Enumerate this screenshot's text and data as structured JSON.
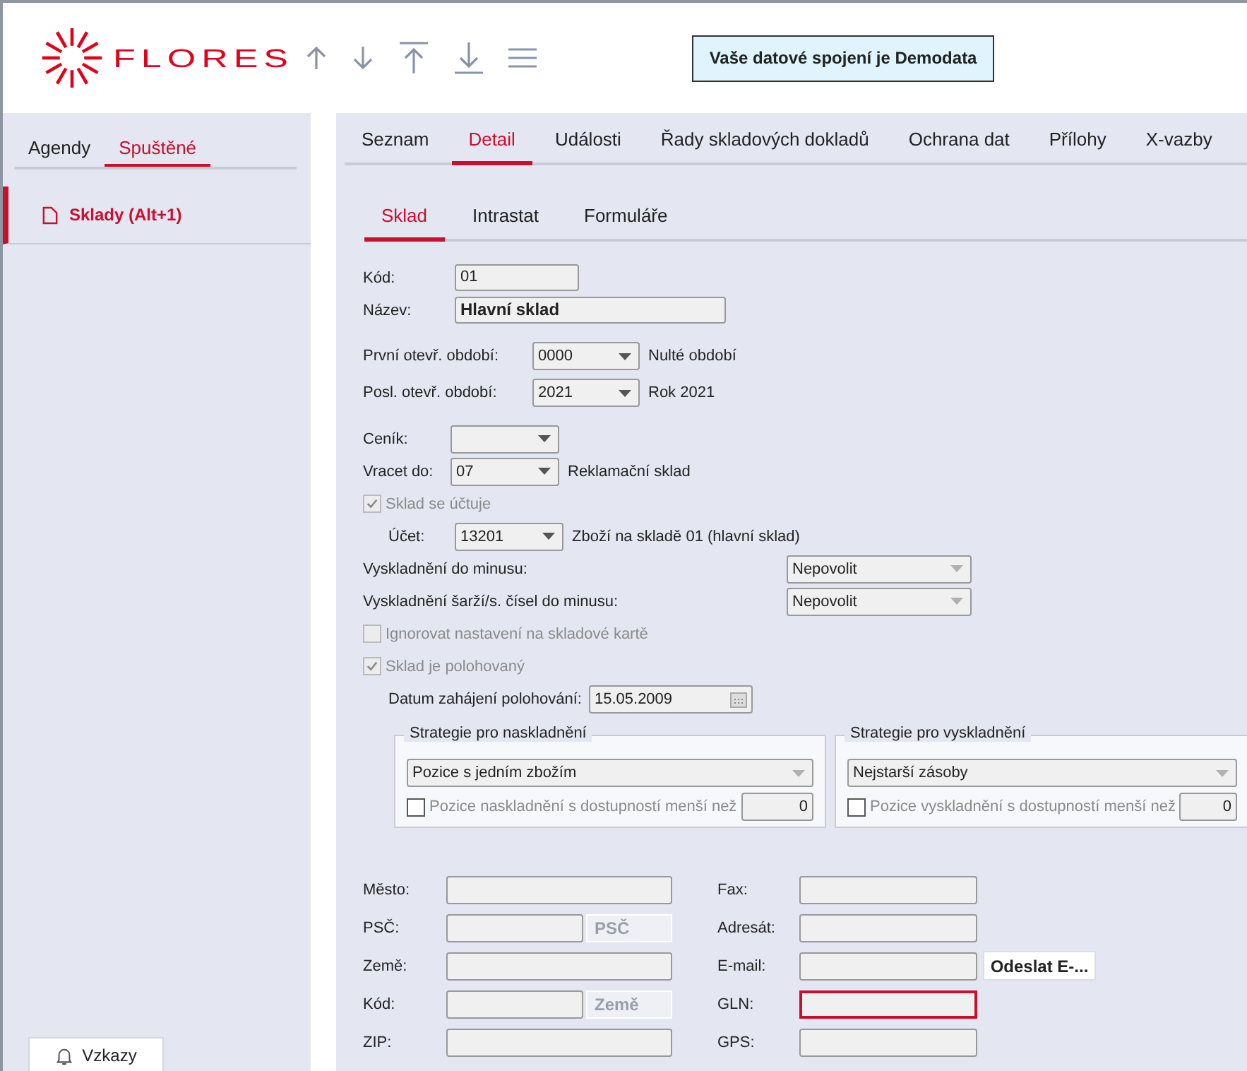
{
  "header": {
    "logo": "FLORES",
    "notice": "Vaše datové spojení je Demodata"
  },
  "sidebar": {
    "tabs": [
      {
        "label": "Agendy",
        "selected": false
      },
      {
        "label": "Spuštěné",
        "selected": true
      }
    ],
    "items": [
      {
        "label": "Sklady (Alt+1)",
        "selected": true
      }
    ],
    "messages_button": "Vzkazy"
  },
  "tabs": [
    {
      "label": "Seznam",
      "selected": false
    },
    {
      "label": "Detail",
      "selected": true
    },
    {
      "label": "Události",
      "selected": false
    },
    {
      "label": "Řady skladových dokladů",
      "selected": false
    },
    {
      "label": "Ochrana dat",
      "selected": false
    },
    {
      "label": "Přílohy",
      "selected": false
    },
    {
      "label": "X-vazby",
      "selected": false
    }
  ],
  "subtabs": [
    {
      "label": "Sklad",
      "selected": true
    },
    {
      "label": "Intrastat",
      "selected": false
    },
    {
      "label": "Formuláře",
      "selected": false
    }
  ],
  "form": {
    "basic": [
      {
        "label": "Kód:",
        "value": "01",
        "emphasis": false
      },
      {
        "label": "Název:",
        "value": "Hlavní sklad",
        "emphasis": true
      }
    ],
    "periods": [
      {
        "label": "První otevř. období:",
        "value": "0000",
        "note": "Nulté období"
      },
      {
        "label": "Posl. otevř. období:",
        "value": "2021",
        "note": "Rok 2021"
      }
    ],
    "lists": [
      {
        "label": "Ceník:"
      },
      {
        "label": "Vracet do:",
        "value": "07",
        "note": "Reklamační sklad"
      }
    ],
    "booked": {
      "label": "Sklad se účtuje",
      "checked": true,
      "disabled": true
    },
    "account": {
      "label": "Účet:",
      "value": "13201",
      "note": "Zboží na skladě 01 (hlavní sklad)"
    },
    "stock_out": [
      {
        "label": "Vyskladnění do minusu:",
        "value": "Nepovolit"
      },
      {
        "label": "Vyskladnění šarží/s. čísel do minusu:",
        "value": "Nepovolit"
      }
    ],
    "checks": [
      {
        "label": "Ignorovat nastavení na skladové kartě",
        "checked": false,
        "disabled": true
      },
      {
        "label": "Sklad je polohovaný",
        "checked": true,
        "disabled": true
      }
    ],
    "position_date": {
      "label": "Datum zahájení polohování:",
      "value": "15.05.2009"
    },
    "strategies": [
      {
        "title": "Strategie pro naskladnění",
        "value": "Pozice s jedním zbožím",
        "check_label": "Pozice naskladnění s dostupností menší než",
        "checked": false,
        "number": "0"
      },
      {
        "title": "Strategie pro vyskladnění",
        "value": "Nejstarší zásoby",
        "check_label": "Pozice vyskladnění s dostupností menší než",
        "checked": false,
        "number": "0"
      }
    ],
    "address": [
      {
        "left": {
          "label": "Město:"
        },
        "right": {
          "label": "Fax:"
        }
      },
      {
        "left": {
          "label": "PSČ:",
          "button": "PSČ"
        },
        "right": {
          "label": "Adresát:"
        }
      },
      {
        "left": {
          "label": "Země:"
        },
        "right": {
          "label": "E-mail:",
          "button": "Odeslat E-..."
        }
      },
      {
        "left": {
          "label": "Kód:",
          "button": "Země"
        },
        "right": {
          "label": "GLN:",
          "focused": true
        }
      },
      {
        "left": {
          "label": "ZIP:"
        },
        "right": {
          "label": "GPS:"
        }
      }
    ]
  }
}
